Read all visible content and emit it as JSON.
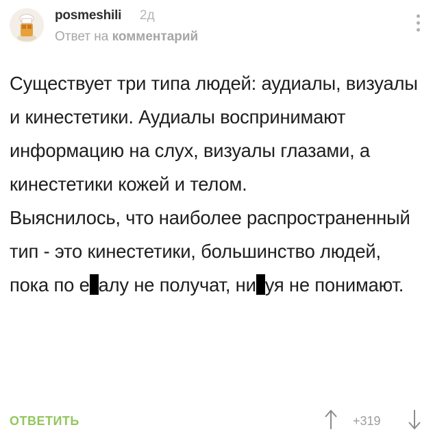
{
  "comment": {
    "author": "posmeshili",
    "time": "2д",
    "reply_prefix": "Ответ на ",
    "reply_link": "комментарий",
    "body": {
      "p1": "Существует три типа людей: аудиалы, визуалы и кинестетики. Аудиалы воспринимают информацию на слух, визуалы глазами, а кинестетики кожей и телом.",
      "p2_a": "Выяснилось, что наиболее распространенный тип - это кинестетики, большинство людей, пока по е",
      "p2_b": "алу не получат, ни",
      "p2_c": "уя не понимают."
    },
    "actions": {
      "reply_label": "ОТВЕТИТЬ",
      "rating": "+319"
    }
  },
  "colors": {
    "accent": "#93c65f",
    "muted": "#a6a6a6",
    "text": "#1e1e1e"
  },
  "icons": {
    "menu": "more-vertical-icon",
    "upvote": "arrow-up-icon",
    "downvote": "arrow-down-icon"
  }
}
